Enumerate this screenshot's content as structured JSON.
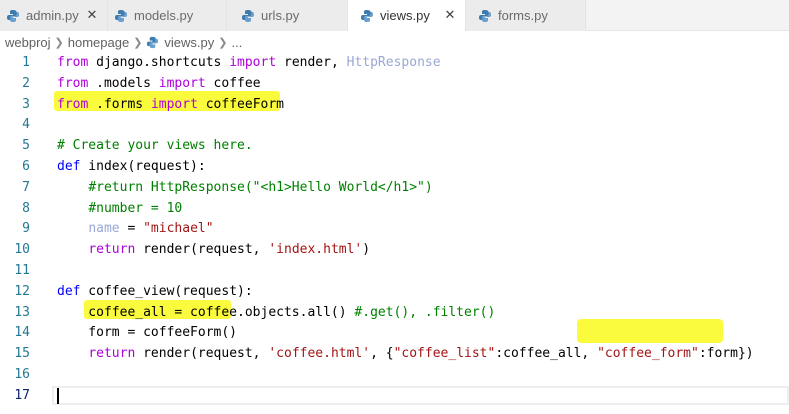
{
  "tabs": [
    {
      "label": "admin.py",
      "active": false,
      "closable": true
    },
    {
      "label": "models.py",
      "active": false,
      "closable": false
    },
    {
      "label": "urls.py",
      "active": false,
      "closable": false
    },
    {
      "label": "views.py",
      "active": true,
      "closable": true
    },
    {
      "label": "forms.py",
      "active": false,
      "closable": false
    }
  ],
  "breadcrumb": {
    "project": "webproj",
    "folder": "homepage",
    "file": "views.py",
    "more": "..."
  },
  "icons": {
    "file_icon": "python-icon",
    "close_icon": "close-icon",
    "chevron": "chevron-right-icon"
  },
  "colors": {
    "highlight": "#fbfb2c",
    "keyword": "#0000ff",
    "control": "#af00db",
    "string": "#a31515",
    "comment": "#008000"
  },
  "editor": {
    "current_line": 17,
    "lines": [
      {
        "num": "1",
        "tokens": [
          [
            "kc",
            "from"
          ],
          [
            "",
            " django.shortcuts "
          ],
          [
            "kc",
            "import"
          ],
          [
            "",
            " render, "
          ],
          [
            "dim",
            "HttpResponse"
          ]
        ]
      },
      {
        "num": "2",
        "tokens": [
          [
            "kc",
            "from"
          ],
          [
            "",
            " .models "
          ],
          [
            "kc",
            "import"
          ],
          [
            "",
            " coffee"
          ]
        ]
      },
      {
        "num": "3",
        "tokens": [
          [
            "kc",
            "from"
          ],
          [
            "",
            " .forms "
          ],
          [
            "kc",
            "import"
          ],
          [
            "",
            " coffeeForm"
          ]
        ]
      },
      {
        "num": "4",
        "tokens": []
      },
      {
        "num": "5",
        "tokens": [
          [
            "cm",
            "# Create your views here."
          ]
        ]
      },
      {
        "num": "6",
        "tokens": [
          [
            "kw",
            "def"
          ],
          [
            "",
            " index(request):"
          ]
        ]
      },
      {
        "num": "7",
        "tokens": [
          [
            "",
            "    "
          ],
          [
            "cm",
            "#return HttpResponse(\"<h1>Hello World</h1>\")"
          ]
        ]
      },
      {
        "num": "8",
        "tokens": [
          [
            "",
            "    "
          ],
          [
            "cm",
            "#number = 10"
          ]
        ]
      },
      {
        "num": "9",
        "tokens": [
          [
            "",
            "    "
          ],
          [
            "dim",
            "name"
          ],
          [
            "",
            " = "
          ],
          [
            "str",
            "\"michael\""
          ]
        ]
      },
      {
        "num": "10",
        "tokens": [
          [
            "",
            "    "
          ],
          [
            "kc",
            "return"
          ],
          [
            "",
            " render(request, "
          ],
          [
            "str",
            "'index.html'"
          ],
          [
            "",
            ")"
          ]
        ]
      },
      {
        "num": "11",
        "tokens": []
      },
      {
        "num": "12",
        "tokens": [
          [
            "kw",
            "def"
          ],
          [
            "",
            " coffee_view(request):"
          ]
        ]
      },
      {
        "num": "13",
        "tokens": [
          [
            "",
            "    coffee_all = coffee.objects.all() "
          ],
          [
            "cm",
            "#.get(), .filter()"
          ]
        ]
      },
      {
        "num": "14",
        "tokens": [
          [
            "",
            "    form = coffeeForm()"
          ]
        ]
      },
      {
        "num": "15",
        "tokens": [
          [
            "",
            "    "
          ],
          [
            "kc",
            "return"
          ],
          [
            "",
            " render(request, "
          ],
          [
            "str",
            "'coffee.html'"
          ],
          [
            "",
            ", {"
          ],
          [
            "str",
            "\"coffee_list\""
          ],
          [
            "",
            ":coffee_all, "
          ],
          [
            "str",
            "\"coffee_form\""
          ],
          [
            "",
            ":form})"
          ]
        ]
      },
      {
        "num": "16",
        "tokens": []
      },
      {
        "num": "17",
        "tokens": []
      }
    ]
  }
}
